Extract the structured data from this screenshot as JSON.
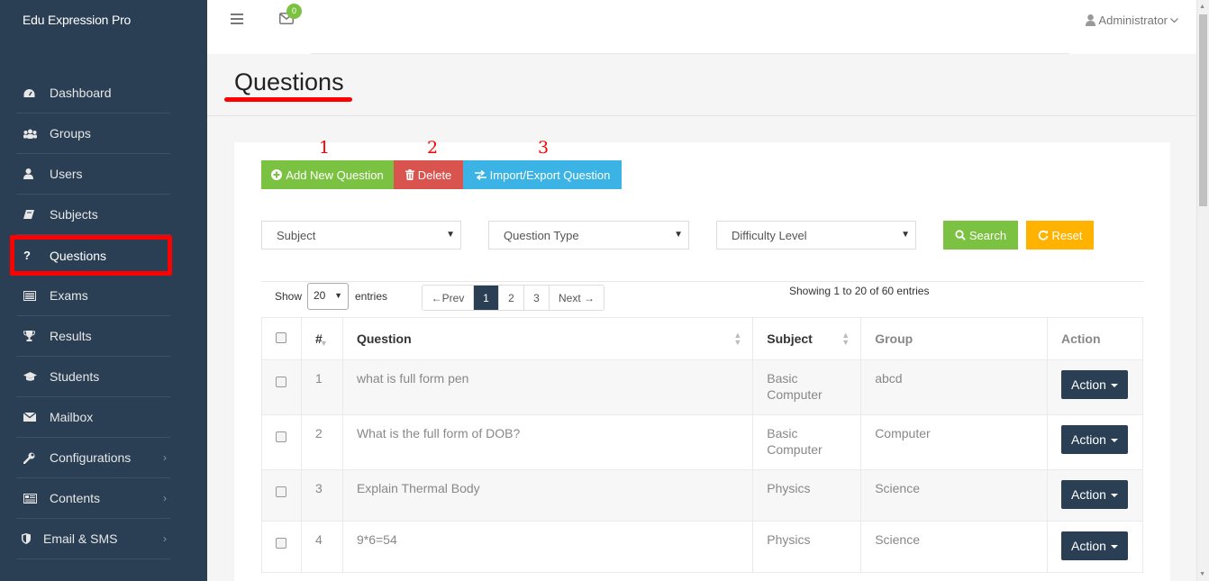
{
  "app": {
    "brand": "Edu Expression Pro"
  },
  "topbar": {
    "mail_count": "0",
    "user": "Administrator"
  },
  "sidebar": {
    "items": [
      {
        "label": "Dashboard",
        "icon": "dashboard-icon"
      },
      {
        "label": "Groups",
        "icon": "groups-icon"
      },
      {
        "label": "Users",
        "icon": "user-icon"
      },
      {
        "label": "Subjects",
        "icon": "book-icon"
      },
      {
        "label": "Questions",
        "icon": "question-icon",
        "active": true
      },
      {
        "label": "Exams",
        "icon": "exam-icon"
      },
      {
        "label": "Results",
        "icon": "trophy-icon"
      },
      {
        "label": "Students",
        "icon": "graduation-cap-icon"
      },
      {
        "label": "Mailbox",
        "icon": "envelope-icon"
      },
      {
        "label": "Configurations",
        "icon": "wrench-icon",
        "has_children": true
      },
      {
        "label": "Contents",
        "icon": "newspaper-icon",
        "has_children": true
      },
      {
        "label": "Email & SMS",
        "icon": "shield-icon",
        "has_children": true
      }
    ]
  },
  "page": {
    "title": "Questions"
  },
  "annotations": [
    "1",
    "2",
    "3"
  ],
  "toolbar": {
    "add_label": "Add New Question",
    "delete_label": "Delete",
    "import_label": "Import/Export Question"
  },
  "filters": {
    "subject": "Subject",
    "question_type": "Question Type",
    "difficulty": "Difficulty Level",
    "search_label": "Search",
    "reset_label": "Reset"
  },
  "list_controls": {
    "show_label": "Show",
    "page_size": "20",
    "entries_label": "entries",
    "pager": [
      "←Prev",
      "1",
      "2",
      "3",
      "Next →"
    ],
    "current_page": "1",
    "info": "Showing 1 to 20 of 60 entries"
  },
  "table": {
    "headers": [
      "#",
      "Question",
      "Subject",
      "Group",
      "Action"
    ],
    "rows": [
      {
        "num": "1",
        "question": "what is full form pen",
        "subject": "Basic Computer",
        "group": "abcd",
        "action": "Action"
      },
      {
        "num": "2",
        "question": "What is the full form of DOB?",
        "subject": "Basic Computer",
        "group": "Computer",
        "action": "Action"
      },
      {
        "num": "3",
        "question": "Explain Thermal Body",
        "subject": "Physics",
        "group": "Science",
        "action": "Action"
      },
      {
        "num": "4",
        "question": "9*6=54",
        "subject": "Physics",
        "group": "Science",
        "action": "Action"
      }
    ]
  },
  "colors": {
    "sidebar": "#2a3f54",
    "accent_green": "#7cc242",
    "danger": "#d9534f",
    "info": "#3bb4e5",
    "warning": "#ffb300",
    "highlight": "#ff0000"
  }
}
